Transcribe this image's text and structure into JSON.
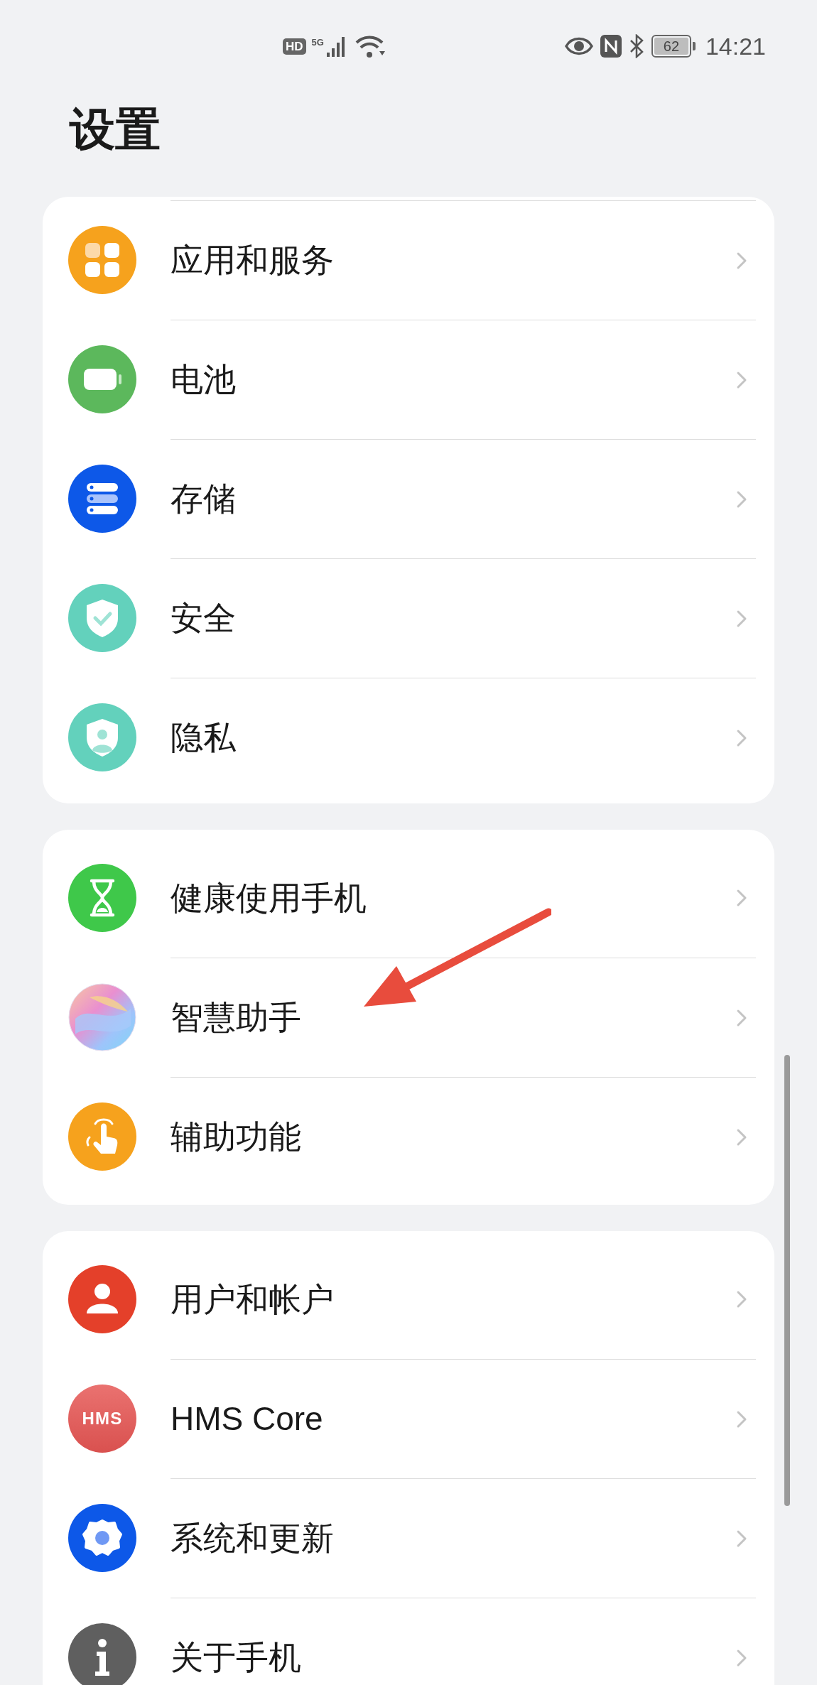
{
  "status_bar": {
    "hd": "HD",
    "network": "5G",
    "battery": "62",
    "time": "14:21"
  },
  "title": "设置",
  "groups": [
    {
      "cut_top": true,
      "items": [
        {
          "kind": "apps",
          "label": "应用和服务"
        },
        {
          "kind": "battery",
          "label": "电池"
        },
        {
          "kind": "storage",
          "label": "存储"
        },
        {
          "kind": "security",
          "label": "安全"
        },
        {
          "kind": "privacy",
          "label": "隐私"
        }
      ]
    },
    {
      "cut_top": false,
      "items": [
        {
          "kind": "hourglass",
          "label": "健康使用手机"
        },
        {
          "kind": "assistant",
          "label": "智慧助手"
        },
        {
          "kind": "accessibility",
          "label": "辅助功能"
        }
      ]
    },
    {
      "cut_top": false,
      "items": [
        {
          "kind": "user",
          "label": "用户和帐户"
        },
        {
          "kind": "hms",
          "label": "HMS Core",
          "icon_text": "HMS"
        },
        {
          "kind": "gear",
          "label": "系统和更新"
        },
        {
          "kind": "info",
          "label": "关于手机"
        }
      ]
    }
  ]
}
